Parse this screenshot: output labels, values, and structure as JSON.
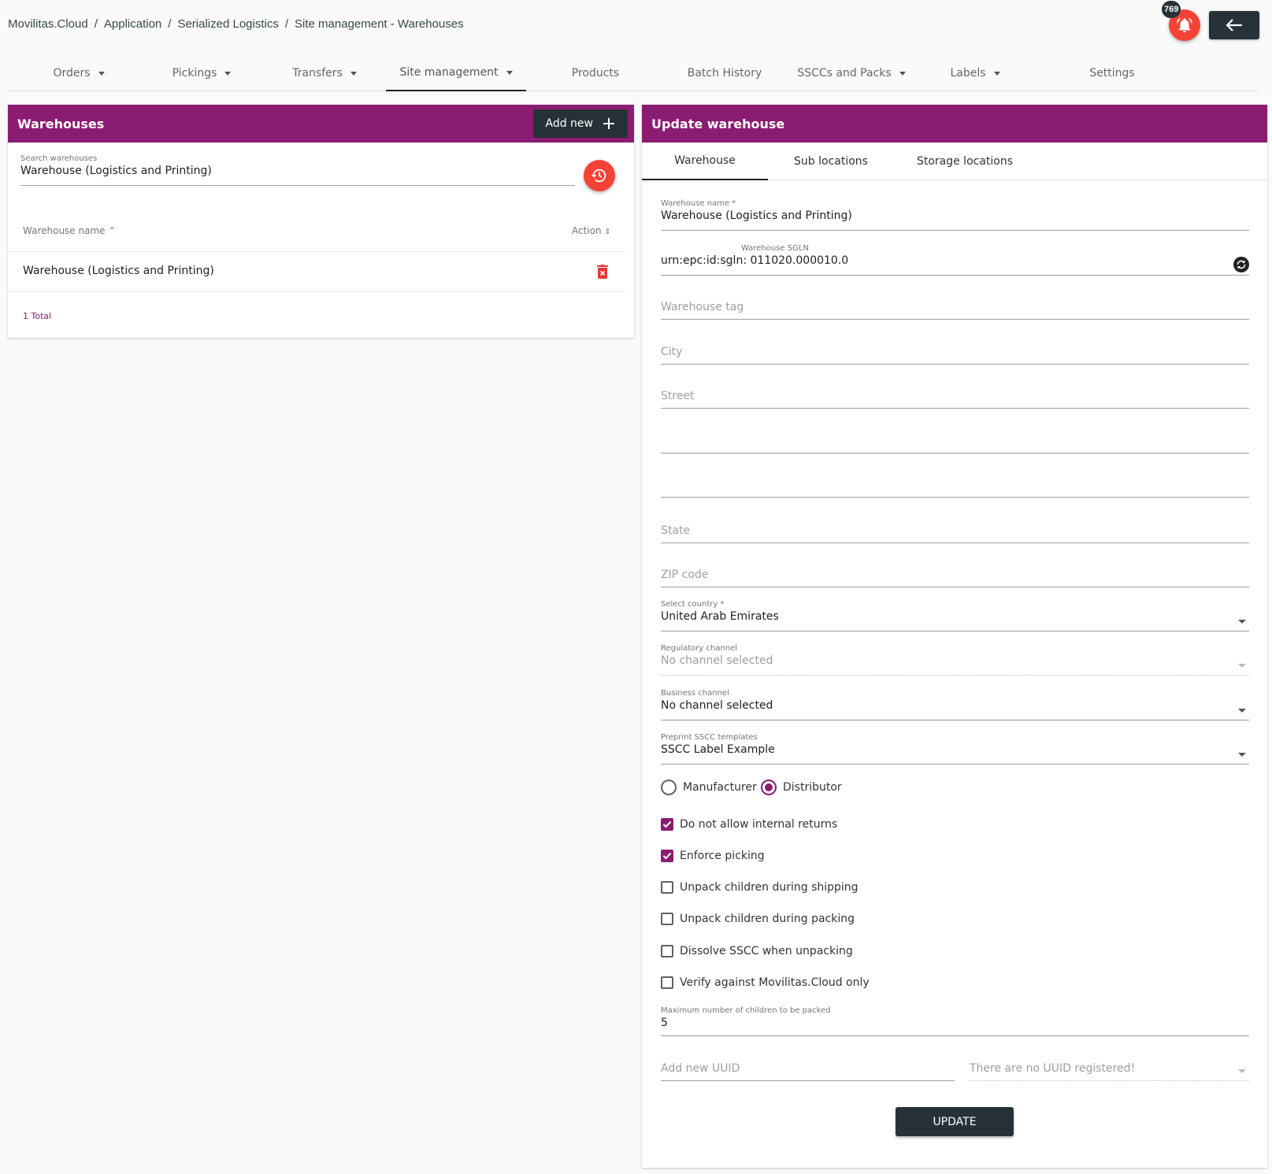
{
  "breadcrumb": [
    "Movilitas.Cloud",
    "Application",
    "Serialized Logistics",
    "Site management - Warehouses"
  ],
  "breadcrumb_sep": "/",
  "notifications": {
    "count": "769"
  },
  "nav": [
    {
      "label": "Orders",
      "dropdown": true
    },
    {
      "label": "Pickings",
      "dropdown": true
    },
    {
      "label": "Transfers",
      "dropdown": true
    },
    {
      "label": "Site management",
      "dropdown": true,
      "active": true
    },
    {
      "label": "Products",
      "dropdown": false
    },
    {
      "label": "Batch History",
      "dropdown": false
    },
    {
      "label": "SSCCs and Packs",
      "dropdown": true
    },
    {
      "label": "Labels",
      "dropdown": true
    },
    {
      "label": "Settings",
      "dropdown": false
    }
  ],
  "left": {
    "title": "Warehouses",
    "add_label": "Add new",
    "search": {
      "label": "Search warehouses",
      "value": "Warehouse (Logistics and Printing)"
    },
    "columns": {
      "name": "Warehouse name",
      "action": "Action"
    },
    "rows": [
      {
        "name": "Warehouse (Logistics and Printing)"
      }
    ],
    "total": "1 Total"
  },
  "right": {
    "title": "Update warehouse",
    "tabs": [
      "Warehouse",
      "Sub locations",
      "Storage locations"
    ],
    "fields": {
      "name": {
        "label": "Warehouse name *",
        "value": "Warehouse (Logistics and Printing)"
      },
      "sgln": {
        "label": "Warehouse SGLN",
        "value": "urn:epc:id:sgln: 011020.000010.0"
      },
      "tag": {
        "placeholder": "Warehouse tag"
      },
      "city": {
        "placeholder": "City"
      },
      "street": {
        "placeholder": "Street"
      },
      "state": {
        "placeholder": "State"
      },
      "zip": {
        "placeholder": "ZIP code"
      },
      "country": {
        "label": "Select country *",
        "value": "United Arab Emirates"
      },
      "regulatory": {
        "label": "Regulatory channel",
        "value": "No channel selected"
      },
      "business": {
        "label": "Business channel",
        "value": "No channel selected"
      },
      "preprint": {
        "label": "Preprint SSCC templates",
        "value": "SSCC Label Example"
      },
      "max_children": {
        "label": "Maximum number of children to be packed",
        "value": "5"
      },
      "uuid_new": {
        "placeholder": "Add new UUID"
      },
      "uuid_list": {
        "value": "There are no UUID registered!"
      }
    },
    "radios": [
      {
        "label": "Manufacturer",
        "checked": false
      },
      {
        "label": "Distributor",
        "checked": true
      }
    ],
    "checks": [
      {
        "label": "Do not allow internal returns",
        "checked": true
      },
      {
        "label": "Enforce picking",
        "checked": true
      },
      {
        "label": "Unpack children during shipping",
        "checked": false
      },
      {
        "label": "Unpack children during packing",
        "checked": false
      },
      {
        "label": "Dissolve SSCC when unpacking",
        "checked": false
      },
      {
        "label": "Verify against Movilitas.Cloud only",
        "checked": false
      }
    ],
    "update_label": "UPDATE"
  },
  "colors": {
    "brand": "#8a1c71",
    "accent": "#f44336",
    "dark": "#263238"
  }
}
